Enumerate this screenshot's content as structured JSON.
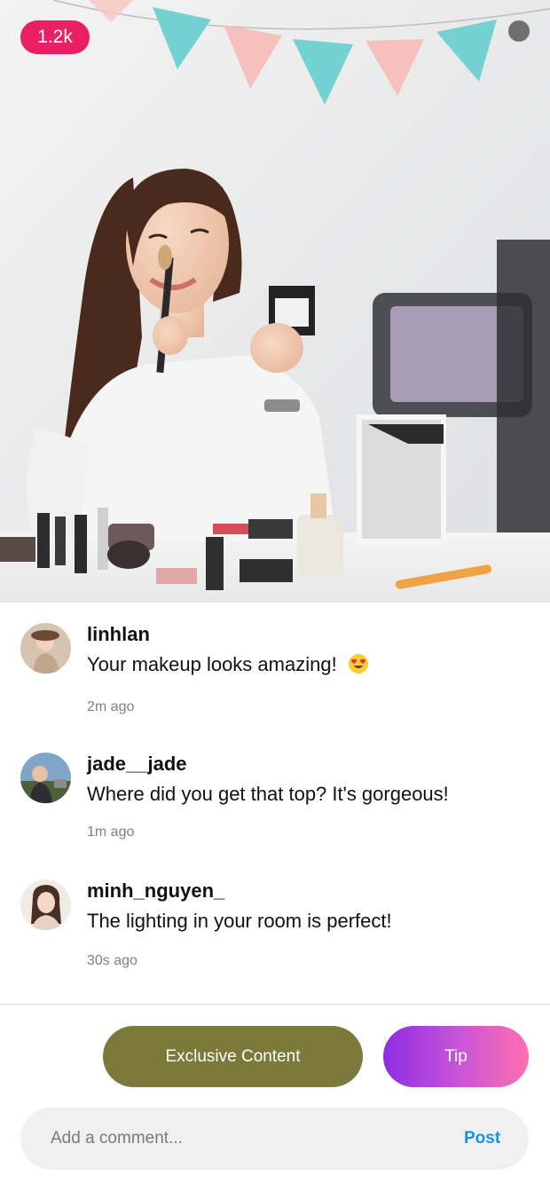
{
  "stream": {
    "viewer_count": "1.2k",
    "status_dot_color": "#6f6f6f",
    "badge_color": "#e91e63"
  },
  "comments": [
    {
      "username": "linhlan",
      "text": "Your makeup looks amazing!",
      "emoji": "heart-eyes-emoji",
      "time": "2m ago"
    },
    {
      "username": "jade__jade",
      "text": "Where did you get that top? It's gorgeous!",
      "time": "1m ago"
    },
    {
      "username": "minh_nguyen_",
      "text": "The lighting in your room is perfect!",
      "time": "30s ago"
    }
  ],
  "actions": {
    "exclusive_label": "Exclusive Content",
    "exclusive_color": "#7b7a3b",
    "tip_label": "Tip"
  },
  "composer": {
    "placeholder": "Add a comment...",
    "post_label": "Post",
    "post_color": "#1493e8"
  }
}
